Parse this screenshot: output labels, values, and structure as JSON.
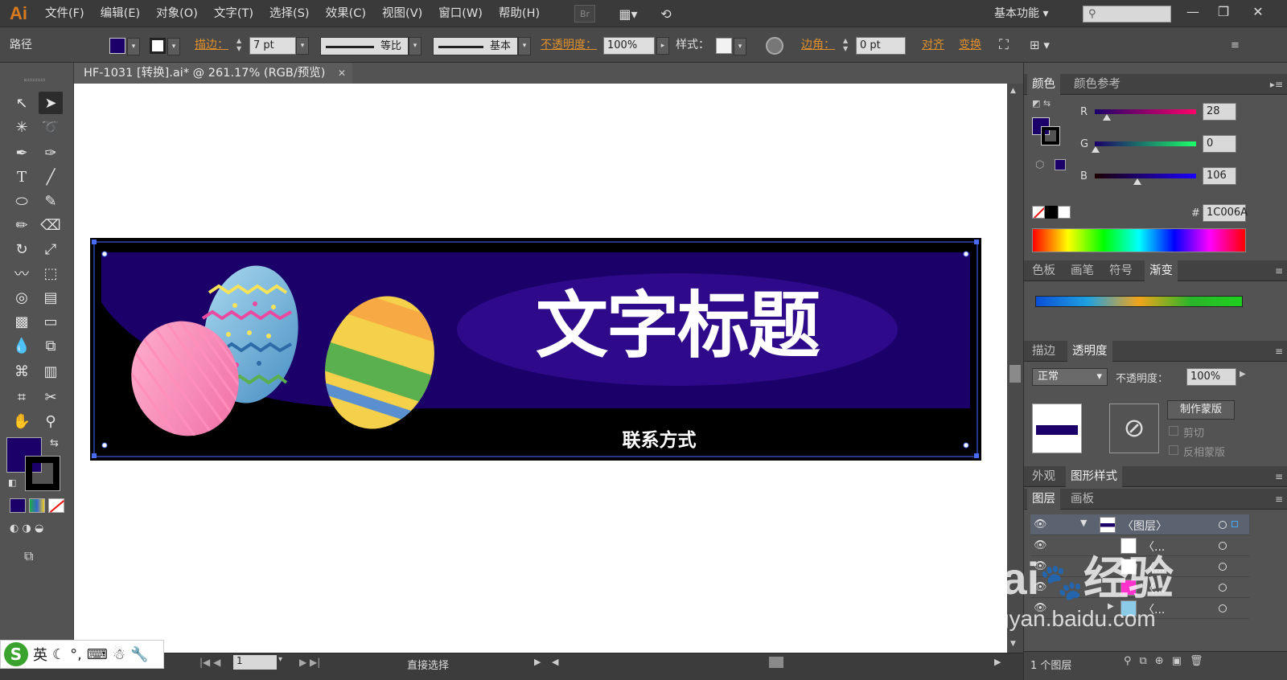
{
  "menubar": {
    "logo": "Ai",
    "items": [
      "文件(F)",
      "编辑(E)",
      "对象(O)",
      "文字(T)",
      "选择(S)",
      "效果(C)",
      "视图(V)",
      "窗口(W)",
      "帮助(H)"
    ],
    "bridge_label": "Br",
    "workspace": "基本功能",
    "search_placeholder": ""
  },
  "controlbar": {
    "object_type": "路径",
    "stroke_label": "描边：",
    "stroke_value": "7 pt",
    "stroke_profile": "等比",
    "brush": "基本",
    "opacity_label": "不透明度：",
    "opacity_value": "100%",
    "style_label": "样式：",
    "corner_label": "边角：",
    "corner_value": "0 pt",
    "align_label": "对齐",
    "transform_label": "变换"
  },
  "document": {
    "tab_title": "HF-1031 [转换].ai* @ 261.17% (RGB/预览)",
    "title_text": "文字标题",
    "contact_text": "联系方式"
  },
  "colors": {
    "fill": "#1C006A",
    "banner_purple": "#1C006A",
    "banner_ellipse": "#2E0A8A",
    "banner_black": "#000000"
  },
  "statusbar": {
    "page_number": "1",
    "tool_name": "直接选择",
    "ime_items": [
      "英"
    ]
  },
  "color_panel": {
    "tabs": [
      "颜色",
      "颜色参考"
    ],
    "r_label": "R",
    "r_value": "28",
    "g_label": "G",
    "g_value": "0",
    "b_label": "B",
    "b_value": "106",
    "hex_label": "#",
    "hex_value": "1C006A"
  },
  "swatch_tabs": [
    "色板",
    "画笔",
    "符号",
    "渐变"
  ],
  "transparency_panel": {
    "tabs": [
      "描边",
      "透明度"
    ],
    "blend_mode": "正常",
    "opacity_label": "不透明度：",
    "opacity_value": "100%",
    "make_mask": "制作蒙版",
    "clip": "剪切",
    "invert_mask": "反相蒙版"
  },
  "appearance_tabs": [
    "外观",
    "图形样式"
  ],
  "layers_panel": {
    "tabs": [
      "图层",
      "画板"
    ],
    "layer_name": "〈图层〉",
    "sublayers": [
      "〈...",
      "〈...",
      "〈...",
      "〈..."
    ],
    "footer": "1 个图层"
  },
  "watermark": {
    "brand": "Bai",
    "brand_cn": "经验",
    "url": "jingyan.baidu.com"
  }
}
